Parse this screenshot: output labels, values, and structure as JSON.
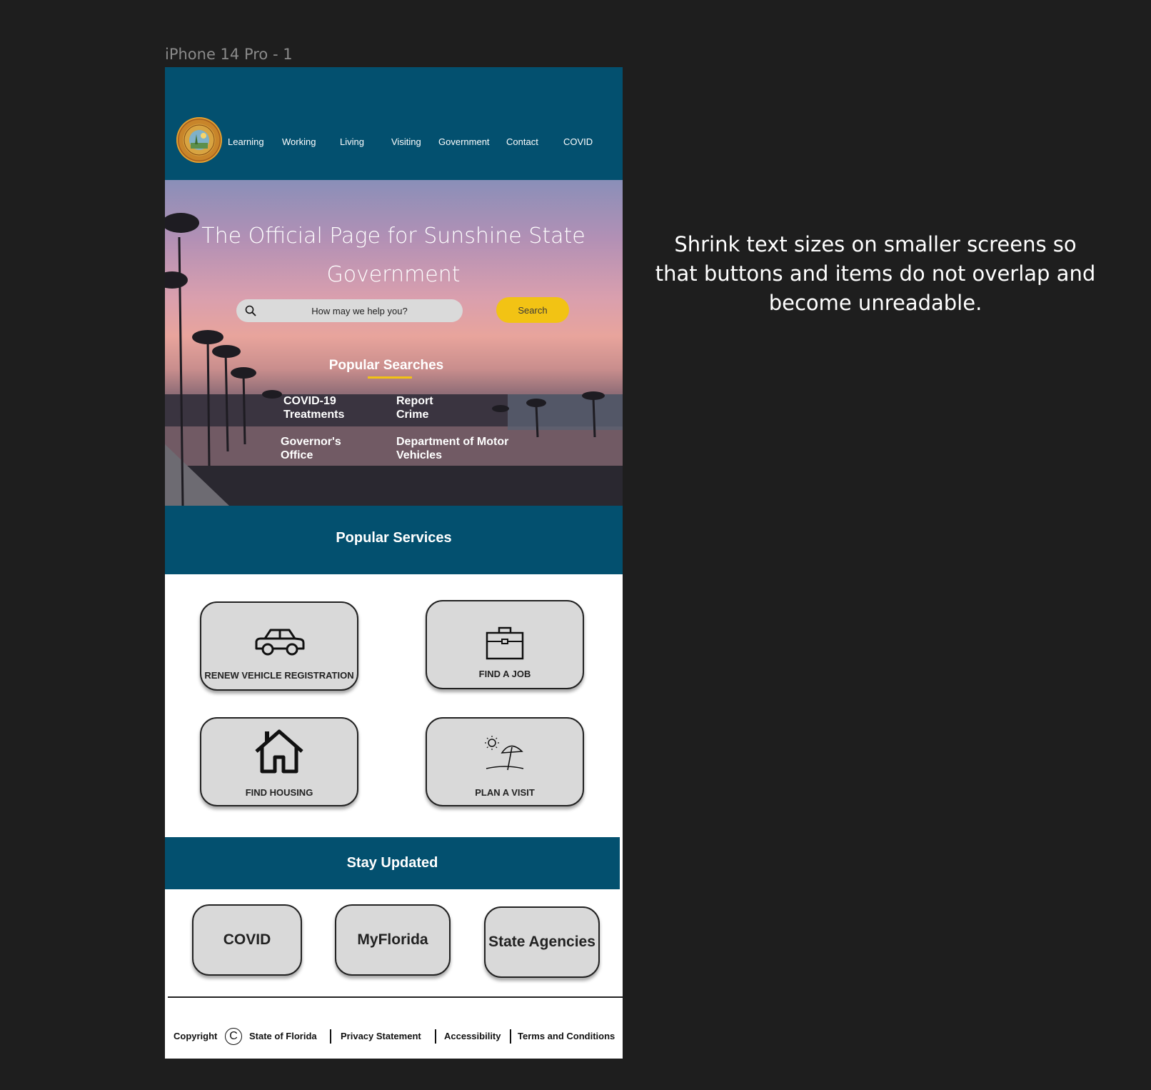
{
  "frame_label": "iPhone 14 Pro - 1",
  "nav": {
    "items": [
      "Learning",
      "Working",
      "Living",
      "Visiting",
      "Government",
      "Contact",
      "COVID"
    ]
  },
  "hero": {
    "title": "The Official Page for Sunshine State Government",
    "search_placeholder": "How may we help you?",
    "search_button": "Search",
    "popular_title": "Popular Searches",
    "popular_links": [
      "COVID-19 Treatments",
      "Report Crime",
      "Governor's Office",
      "Department of Motor Vehicles"
    ]
  },
  "services": {
    "title": "Popular Services",
    "cards": [
      {
        "label": "RENEW VEHICLE REGISTRATION",
        "icon": "car-icon"
      },
      {
        "label": "FIND A JOB",
        "icon": "briefcase-icon"
      },
      {
        "label": "FIND HOUSING",
        "icon": "house-icon"
      },
      {
        "label": "PLAN A VISIT",
        "icon": "beach-icon"
      }
    ]
  },
  "stay_updated": {
    "title": "Stay Updated",
    "buttons": [
      "COVID",
      "MyFlorida",
      "State Agencies"
    ]
  },
  "footer": {
    "copyright": "Copyright",
    "copyright_symbol": "C",
    "state": "State of Florida",
    "privacy": "Privacy Statement",
    "accessibility": "Accessibility",
    "terms": "Terms and Conditions"
  },
  "annotation": "Shrink text sizes on smaller screens so that buttons and items do not overlap and become unreadable.",
  "colors": {
    "primary": "#03506f",
    "accent": "#f2c314",
    "card": "#d9d9d9",
    "canvas": "#1e1e1e"
  }
}
